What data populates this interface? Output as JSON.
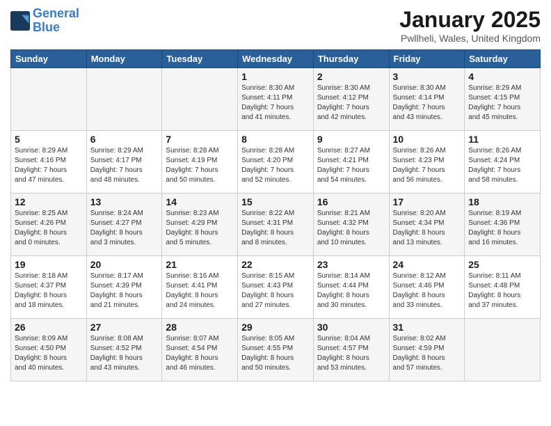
{
  "header": {
    "logo_line1": "General",
    "logo_line2": "Blue",
    "title": "January 2025",
    "location": "Pwllheli, Wales, United Kingdom"
  },
  "days_of_week": [
    "Sunday",
    "Monday",
    "Tuesday",
    "Wednesday",
    "Thursday",
    "Friday",
    "Saturday"
  ],
  "weeks": [
    [
      {
        "num": "",
        "info": ""
      },
      {
        "num": "",
        "info": ""
      },
      {
        "num": "",
        "info": ""
      },
      {
        "num": "1",
        "info": "Sunrise: 8:30 AM\nSunset: 4:11 PM\nDaylight: 7 hours\nand 41 minutes."
      },
      {
        "num": "2",
        "info": "Sunrise: 8:30 AM\nSunset: 4:12 PM\nDaylight: 7 hours\nand 42 minutes."
      },
      {
        "num": "3",
        "info": "Sunrise: 8:30 AM\nSunset: 4:14 PM\nDaylight: 7 hours\nand 43 minutes."
      },
      {
        "num": "4",
        "info": "Sunrise: 8:29 AM\nSunset: 4:15 PM\nDaylight: 7 hours\nand 45 minutes."
      }
    ],
    [
      {
        "num": "5",
        "info": "Sunrise: 8:29 AM\nSunset: 4:16 PM\nDaylight: 7 hours\nand 47 minutes."
      },
      {
        "num": "6",
        "info": "Sunrise: 8:29 AM\nSunset: 4:17 PM\nDaylight: 7 hours\nand 48 minutes."
      },
      {
        "num": "7",
        "info": "Sunrise: 8:28 AM\nSunset: 4:19 PM\nDaylight: 7 hours\nand 50 minutes."
      },
      {
        "num": "8",
        "info": "Sunrise: 8:28 AM\nSunset: 4:20 PM\nDaylight: 7 hours\nand 52 minutes."
      },
      {
        "num": "9",
        "info": "Sunrise: 8:27 AM\nSunset: 4:21 PM\nDaylight: 7 hours\nand 54 minutes."
      },
      {
        "num": "10",
        "info": "Sunrise: 8:26 AM\nSunset: 4:23 PM\nDaylight: 7 hours\nand 56 minutes."
      },
      {
        "num": "11",
        "info": "Sunrise: 8:26 AM\nSunset: 4:24 PM\nDaylight: 7 hours\nand 58 minutes."
      }
    ],
    [
      {
        "num": "12",
        "info": "Sunrise: 8:25 AM\nSunset: 4:26 PM\nDaylight: 8 hours\nand 0 minutes."
      },
      {
        "num": "13",
        "info": "Sunrise: 8:24 AM\nSunset: 4:27 PM\nDaylight: 8 hours\nand 3 minutes."
      },
      {
        "num": "14",
        "info": "Sunrise: 8:23 AM\nSunset: 4:29 PM\nDaylight: 8 hours\nand 5 minutes."
      },
      {
        "num": "15",
        "info": "Sunrise: 8:22 AM\nSunset: 4:31 PM\nDaylight: 8 hours\nand 8 minutes."
      },
      {
        "num": "16",
        "info": "Sunrise: 8:21 AM\nSunset: 4:32 PM\nDaylight: 8 hours\nand 10 minutes."
      },
      {
        "num": "17",
        "info": "Sunrise: 8:20 AM\nSunset: 4:34 PM\nDaylight: 8 hours\nand 13 minutes."
      },
      {
        "num": "18",
        "info": "Sunrise: 8:19 AM\nSunset: 4:36 PM\nDaylight: 8 hours\nand 16 minutes."
      }
    ],
    [
      {
        "num": "19",
        "info": "Sunrise: 8:18 AM\nSunset: 4:37 PM\nDaylight: 8 hours\nand 18 minutes."
      },
      {
        "num": "20",
        "info": "Sunrise: 8:17 AM\nSunset: 4:39 PM\nDaylight: 8 hours\nand 21 minutes."
      },
      {
        "num": "21",
        "info": "Sunrise: 8:16 AM\nSunset: 4:41 PM\nDaylight: 8 hours\nand 24 minutes."
      },
      {
        "num": "22",
        "info": "Sunrise: 8:15 AM\nSunset: 4:43 PM\nDaylight: 8 hours\nand 27 minutes."
      },
      {
        "num": "23",
        "info": "Sunrise: 8:14 AM\nSunset: 4:44 PM\nDaylight: 8 hours\nand 30 minutes."
      },
      {
        "num": "24",
        "info": "Sunrise: 8:12 AM\nSunset: 4:46 PM\nDaylight: 8 hours\nand 33 minutes."
      },
      {
        "num": "25",
        "info": "Sunrise: 8:11 AM\nSunset: 4:48 PM\nDaylight: 8 hours\nand 37 minutes."
      }
    ],
    [
      {
        "num": "26",
        "info": "Sunrise: 8:09 AM\nSunset: 4:50 PM\nDaylight: 8 hours\nand 40 minutes."
      },
      {
        "num": "27",
        "info": "Sunrise: 8:08 AM\nSunset: 4:52 PM\nDaylight: 8 hours\nand 43 minutes."
      },
      {
        "num": "28",
        "info": "Sunrise: 8:07 AM\nSunset: 4:54 PM\nDaylight: 8 hours\nand 46 minutes."
      },
      {
        "num": "29",
        "info": "Sunrise: 8:05 AM\nSunset: 4:55 PM\nDaylight: 8 hours\nand 50 minutes."
      },
      {
        "num": "30",
        "info": "Sunrise: 8:04 AM\nSunset: 4:57 PM\nDaylight: 8 hours\nand 53 minutes."
      },
      {
        "num": "31",
        "info": "Sunrise: 8:02 AM\nSunset: 4:59 PM\nDaylight: 8 hours\nand 57 minutes."
      },
      {
        "num": "",
        "info": ""
      }
    ]
  ]
}
